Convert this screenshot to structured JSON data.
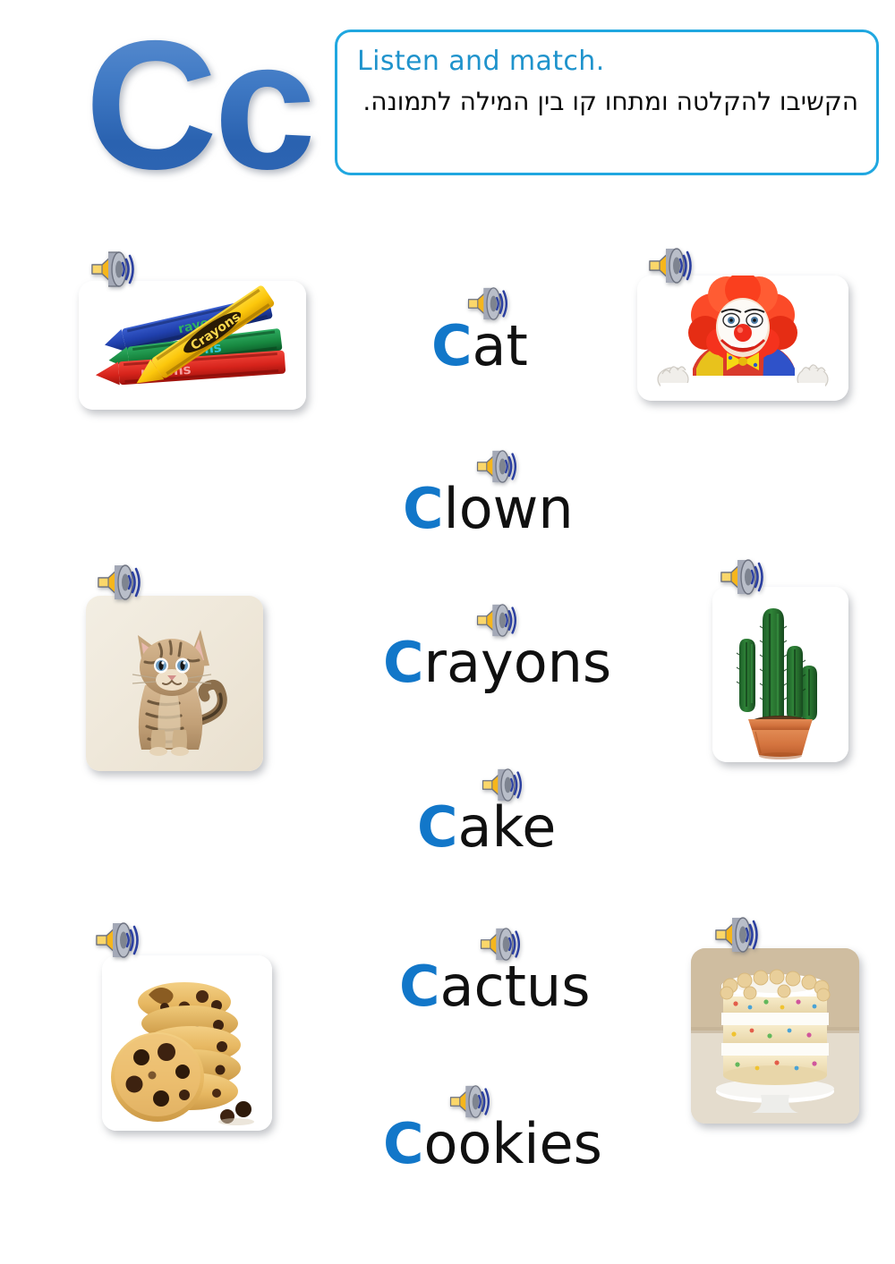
{
  "page": {
    "letter": "Cc",
    "background_color": "#ffffff",
    "accent_color": "#1277c9",
    "box_border_color": "#20a7e0"
  },
  "header": {
    "letter_display": "Cc",
    "instruction_en": "Listen and match.",
    "instruction_he": "הקשיבו להקלטה ומתחו קו בין המילה לתמונה.",
    "instruction_en_color": "#1f93cc",
    "instruction_he_color": "#0b0b0b"
  },
  "icons": {
    "speaker": "speaker-icon",
    "speaker_cone_color": "#f5b820",
    "speaker_body_color": "#8f94a3",
    "speaker_wave_color": "#2b3fa0"
  },
  "picture_cards": [
    {
      "id": "crayons",
      "label": "crayons",
      "alt": "Four wax crayons — yellow, blue, green and red — stacked on a white background",
      "column": "left",
      "row": 1,
      "has_audio": true
    },
    {
      "id": "clown",
      "label": "clown",
      "alt": "Smiling clown with bright red curly wig, white face paint, red nose and colourful costume peeking over a white board",
      "column": "right",
      "row": 1,
      "has_audio": true
    },
    {
      "id": "cat",
      "label": "cat",
      "alt": "Striped tabby kitten sitting on a cream background",
      "column": "left",
      "row": 2,
      "has_audio": true
    },
    {
      "id": "cactus",
      "label": "cactus",
      "alt": "Tall green columnar cactus with four arms in a terracotta pot",
      "column": "right",
      "row": 2,
      "has_audio": true
    },
    {
      "id": "cookies",
      "label": "cookies",
      "alt": "Stack of chocolate chip cookies with loose chocolate chips",
      "column": "left",
      "row": 3,
      "has_audio": true
    },
    {
      "id": "cake",
      "label": "cake",
      "alt": "Three layer funfetti cake with white cream frosting on a white cake stand",
      "column": "right",
      "row": 3,
      "has_audio": true
    }
  ],
  "words": [
    {
      "id": "cat",
      "initial": "C",
      "rest": "at",
      "full": "Cat",
      "has_audio": true
    },
    {
      "id": "clown",
      "initial": "C",
      "rest": "lown",
      "full": "Clown",
      "has_audio": true
    },
    {
      "id": "crayons",
      "initial": "C",
      "rest": "rayons",
      "full": "Crayons",
      "has_audio": true
    },
    {
      "id": "cake",
      "initial": "C",
      "rest": "ake",
      "full": "Cake",
      "has_audio": true
    },
    {
      "id": "cactus",
      "initial": "C",
      "rest": "actus",
      "full": "Cactus",
      "has_audio": true
    },
    {
      "id": "cookies",
      "initial": "C",
      "rest": "ookies",
      "full": "Cookies",
      "has_audio": true
    }
  ]
}
